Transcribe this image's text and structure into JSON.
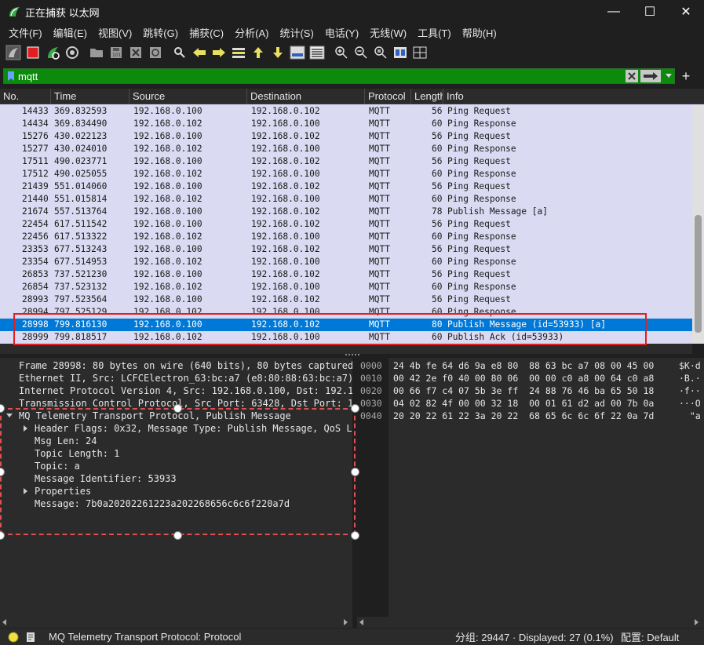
{
  "window": {
    "title": "正在捕获 以太网",
    "minimize": "—",
    "maximize": "☐",
    "close": "✕"
  },
  "menu": [
    "文件(F)",
    "编辑(E)",
    "视图(V)",
    "跳转(G)",
    "捕获(C)",
    "分析(A)",
    "统计(S)",
    "电话(Y)",
    "无线(W)",
    "工具(T)",
    "帮助(H)"
  ],
  "toolbar": {
    "icons": [
      "shark-fin-icon",
      "stop-icon",
      "restart-icon",
      "options-gear-icon",
      "open-folder-icon",
      "save-icon",
      "close-file-icon",
      "reload-icon",
      "find-icon",
      "back-arrow-icon",
      "forward-arrow-icon",
      "goto-packet-icon",
      "first-packet-icon",
      "last-packet-icon",
      "auto-scroll-icon",
      "colorize-icon",
      "zoom-in-icon",
      "zoom-out-icon",
      "zoom-normal-icon",
      "resize-columns-icon",
      "layout-icon"
    ]
  },
  "filter": {
    "value": "mqtt",
    "clear_icon": "clear-icon",
    "apply_icon": "apply-arrow-icon"
  },
  "packet_list": {
    "columns": [
      "No.",
      "Time",
      "Source",
      "Destination",
      "Protocol",
      "Length",
      "Info"
    ],
    "rows": [
      {
        "no": "14433",
        "time": "369.832593",
        "src": "192.168.0.100",
        "dst": "192.168.0.102",
        "proto": "MQTT",
        "len": "56",
        "info": "Ping Request"
      },
      {
        "no": "14434",
        "time": "369.834490",
        "src": "192.168.0.102",
        "dst": "192.168.0.100",
        "proto": "MQTT",
        "len": "60",
        "info": "Ping Response"
      },
      {
        "no": "15276",
        "time": "430.022123",
        "src": "192.168.0.100",
        "dst": "192.168.0.102",
        "proto": "MQTT",
        "len": "56",
        "info": "Ping Request"
      },
      {
        "no": "15277",
        "time": "430.024010",
        "src": "192.168.0.102",
        "dst": "192.168.0.100",
        "proto": "MQTT",
        "len": "60",
        "info": "Ping Response"
      },
      {
        "no": "17511",
        "time": "490.023771",
        "src": "192.168.0.100",
        "dst": "192.168.0.102",
        "proto": "MQTT",
        "len": "56",
        "info": "Ping Request"
      },
      {
        "no": "17512",
        "time": "490.025055",
        "src": "192.168.0.102",
        "dst": "192.168.0.100",
        "proto": "MQTT",
        "len": "60",
        "info": "Ping Response"
      },
      {
        "no": "21439",
        "time": "551.014060",
        "src": "192.168.0.100",
        "dst": "192.168.0.102",
        "proto": "MQTT",
        "len": "56",
        "info": "Ping Request"
      },
      {
        "no": "21440",
        "time": "551.015814",
        "src": "192.168.0.102",
        "dst": "192.168.0.100",
        "proto": "MQTT",
        "len": "60",
        "info": "Ping Response"
      },
      {
        "no": "21674",
        "time": "557.513764",
        "src": "192.168.0.100",
        "dst": "192.168.0.102",
        "proto": "MQTT",
        "len": "78",
        "info": "Publish Message [a]"
      },
      {
        "no": "22454",
        "time": "617.511542",
        "src": "192.168.0.100",
        "dst": "192.168.0.102",
        "proto": "MQTT",
        "len": "56",
        "info": "Ping Request"
      },
      {
        "no": "22456",
        "time": "617.513322",
        "src": "192.168.0.102",
        "dst": "192.168.0.100",
        "proto": "MQTT",
        "len": "60",
        "info": "Ping Response"
      },
      {
        "no": "23353",
        "time": "677.513243",
        "src": "192.168.0.100",
        "dst": "192.168.0.102",
        "proto": "MQTT",
        "len": "56",
        "info": "Ping Request"
      },
      {
        "no": "23354",
        "time": "677.514953",
        "src": "192.168.0.102",
        "dst": "192.168.0.100",
        "proto": "MQTT",
        "len": "60",
        "info": "Ping Response"
      },
      {
        "no": "26853",
        "time": "737.521230",
        "src": "192.168.0.100",
        "dst": "192.168.0.102",
        "proto": "MQTT",
        "len": "56",
        "info": "Ping Request"
      },
      {
        "no": "26854",
        "time": "737.523132",
        "src": "192.168.0.102",
        "dst": "192.168.0.100",
        "proto": "MQTT",
        "len": "60",
        "info": "Ping Response"
      },
      {
        "no": "28993",
        "time": "797.523564",
        "src": "192.168.0.100",
        "dst": "192.168.0.102",
        "proto": "MQTT",
        "len": "56",
        "info": "Ping Request"
      },
      {
        "no": "28994",
        "time": "797.525129",
        "src": "192.168.0.102",
        "dst": "192.168.0.100",
        "proto": "MQTT",
        "len": "60",
        "info": "Ping Response"
      },
      {
        "no": "28998",
        "time": "799.816130",
        "src": "192.168.0.100",
        "dst": "192.168.0.102",
        "proto": "MQTT",
        "len": "80",
        "info": "Publish Message (id=53933) [a]",
        "selected": true
      },
      {
        "no": "28999",
        "time": "799.818517",
        "src": "192.168.0.102",
        "dst": "192.168.0.100",
        "proto": "MQTT",
        "len": "60",
        "info": "Publish Ack (id=53933)"
      }
    ]
  },
  "details": {
    "frame": "Frame 28998: 80 bytes on wire (640 bits), 80 bytes captured",
    "ethernet": "Ethernet II, Src: LCFCElectron_63:bc:a7 (e8:80:88:63:bc:a7)",
    "ip": "Internet Protocol Version 4, Src: 192.168.0.100, Dst: 192.1",
    "tcp": "Transmission Control Protocol, Src Port: 63428, Dst Port: 1",
    "mqtt": "MQ Telemetry Transport Protocol, Publish Message",
    "header_flags": "Header Flags: 0x32, Message Type: Publish Message, QoS L",
    "msg_len": "Msg Len: 24",
    "topic_len": "Topic Length: 1",
    "topic": "Topic: a",
    "msg_id": "Message Identifier: 53933",
    "properties": "Properties",
    "message": "Message: 7b0a20202261223a202268656c6c6f220a7d"
  },
  "bytes": {
    "offsets": [
      "0000",
      "0010",
      "0020",
      "0030",
      "0040"
    ],
    "hex": [
      "24 4b fe 64 d6 9a e8 80  88 63 bc a7 08 00 45 00",
      "00 42 2e f0 40 00 80 06  00 00 c0 a8 00 64 c0 a8",
      "00 66 f7 c4 07 5b 3e ff  24 88 76 46 ba 65 50 18",
      "04 02 82 4f 00 00 32 18  00 01 61 d2 ad 00 7b 0a",
      "20 20 22 61 22 3a 20 22  68 65 6c 6c 6f 22 0a 7d"
    ],
    "ascii": [
      "$K·d",
      "·B.·",
      "·f··",
      "···O",
      "  \"a"
    ]
  },
  "status": {
    "text": "MQ Telemetry Transport Protocol: Protocol",
    "packets": "分组: 29447 · Displayed: 27 (0.1%)",
    "profile": "配置: Default"
  },
  "colors": {
    "filter_ok": "#0b8a0b",
    "row_bg": "#dadaf2",
    "selected_row": "#0078d7",
    "annotation": "#e02020"
  }
}
